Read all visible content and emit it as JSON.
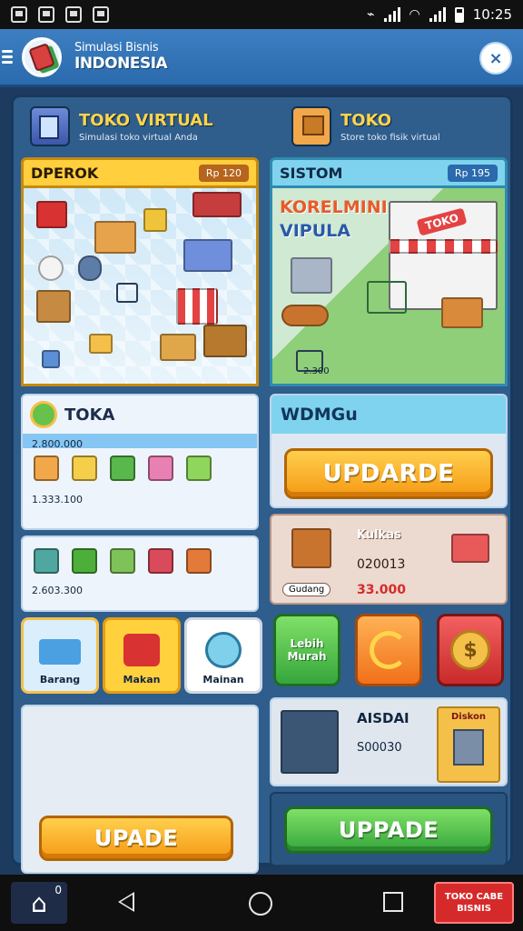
{
  "status_bar": {
    "time": "10:25",
    "icons": [
      "gallery-icon",
      "gallery-icon",
      "gallery-icon",
      "gallery-icon",
      "vibrate-icon",
      "signal-icon",
      "wifi-icon",
      "signal-icon",
      "battery-icon"
    ]
  },
  "header": {
    "title_line1": "Simulasi Bisnis",
    "title_line2": "INDONESIA",
    "close_label": "×"
  },
  "stores": {
    "left": {
      "title": "TOKO VIRTUAL",
      "subtitle": "Simulasi toko virtual Anda",
      "card_title": "DPEROK",
      "card_badge": "Rp 120",
      "list_title": "TOKA",
      "list_value_1": "2.800.000",
      "list_value_2": "1.333.100",
      "list_value_3": "2.603.300",
      "categories": [
        "Barang",
        "Makan",
        "Mainan"
      ],
      "button_label": "UPADE"
    },
    "right": {
      "title": "TOKO",
      "subtitle": "Store toko fisik virtual",
      "card_title": "SISTOM",
      "card_badge": "Rp 195",
      "overlay_line1": "KORELMINI",
      "overlay_line2": "VIPULA",
      "shop_sign": "TOKO",
      "scene_counter": "2.300",
      "section_title": "WDMGu",
      "update_label": "UPDARDE",
      "asset_name": "Kulkas",
      "asset_value": "020013",
      "asset_tag": "Gudang",
      "asset_price": "33.000",
      "tile_labels": [
        "Lebih Murah",
        "",
        "$"
      ],
      "vehicle_name": "AISDAI",
      "vehicle_value": "S00030",
      "vehicle_tag": "Diskon",
      "button_label": "UPPADE"
    }
  },
  "nav": {
    "home_badge": "0",
    "promo_line1": "TOKO CABE",
    "promo_line2": "BISNIS"
  },
  "colors": {
    "header_blue": "#2f73b8",
    "panel_blue": "#2f5d8c",
    "accent_yellow": "#ffd54a",
    "orange_button": "#f59a14",
    "green_button": "#36a63c",
    "promo_red": "#d62a2a"
  }
}
